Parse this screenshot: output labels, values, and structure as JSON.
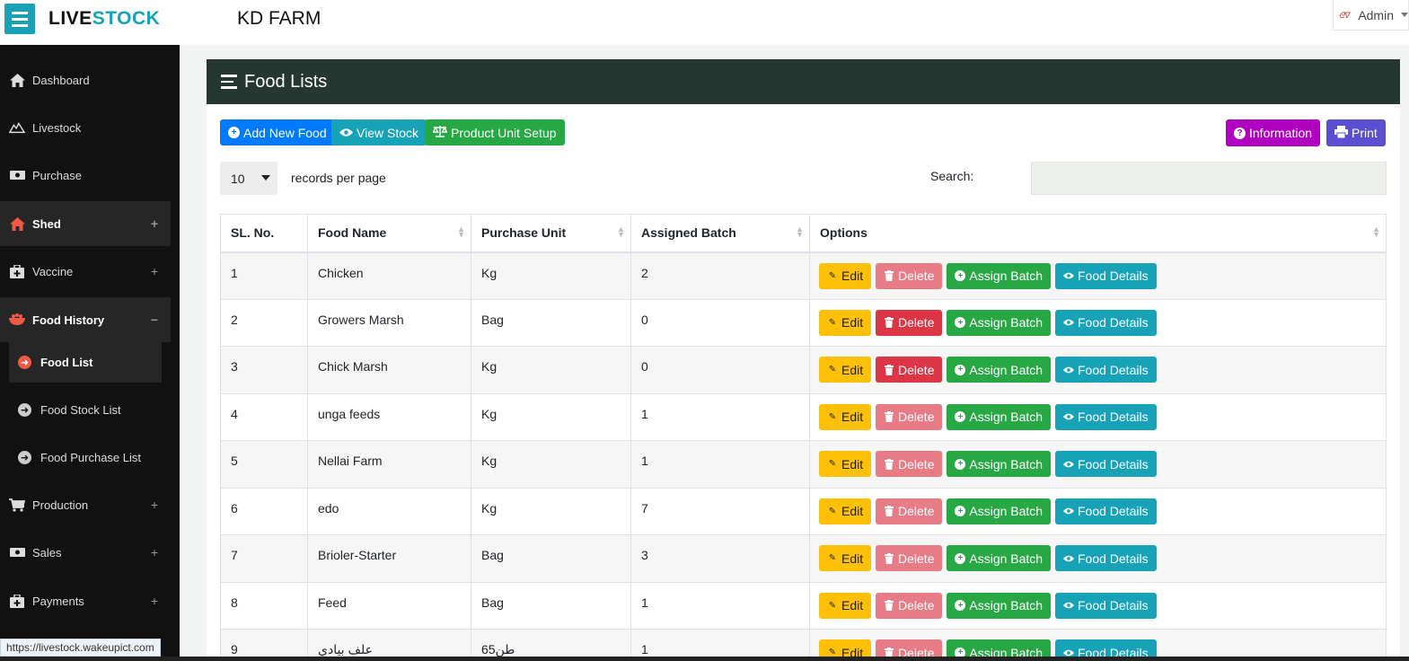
{
  "header": {
    "brand_part1": "LIVE",
    "brand_part2": "STOCK",
    "farm_name": "KD FARM",
    "user_label": "Admin"
  },
  "sidebar": {
    "items": [
      {
        "label": "Dashboard",
        "icon": "home-icon"
      },
      {
        "label": "Livestock",
        "icon": "livestock-icon"
      },
      {
        "label": "Purchase",
        "icon": "money-icon"
      },
      {
        "label": "Shed",
        "icon": "home-icon",
        "expand": "+"
      },
      {
        "label": "Vaccine",
        "icon": "medkit-icon",
        "expand": "+"
      },
      {
        "label": "Food History",
        "icon": "food-bowl-icon",
        "expand": "−"
      },
      {
        "label": "Production",
        "icon": "cart-icon",
        "expand": "+"
      },
      {
        "label": "Sales",
        "icon": "money-icon",
        "expand": "+"
      },
      {
        "label": "Payments",
        "icon": "medkit-icon",
        "expand": "+"
      }
    ],
    "sub_items": [
      {
        "label": "Food List",
        "active": true
      },
      {
        "label": "Food Stock List"
      },
      {
        "label": "Food Purchase List"
      }
    ]
  },
  "page": {
    "title": "Food Lists",
    "buttons": {
      "add_new_food": "Add New Food",
      "view_stock": "View Stock",
      "product_unit_setup": "Product Unit Setup",
      "information": "Information",
      "print": "Print"
    },
    "records_per_page_value": "10",
    "records_per_page_label": "records per page",
    "search_label": "Search:",
    "search_value": ""
  },
  "table": {
    "columns": [
      "SL. No.",
      "Food Name",
      "Purchase Unit",
      "Assigned Batch",
      "Options"
    ],
    "option_labels": {
      "edit": "Edit",
      "delete": "Delete",
      "assign_batch": "Assign Batch",
      "food_details": "Food Details"
    },
    "rows": [
      {
        "sl": "1",
        "name": "Chicken",
        "unit": "Kg",
        "batch": "2",
        "delete_enabled": false
      },
      {
        "sl": "2",
        "name": "Growers Marsh",
        "unit": "Bag",
        "batch": "0",
        "delete_enabled": true
      },
      {
        "sl": "3",
        "name": "Chick Marsh",
        "unit": "Kg",
        "batch": "0",
        "delete_enabled": true
      },
      {
        "sl": "4",
        "name": "unga feeds",
        "unit": "Kg",
        "batch": "1",
        "delete_enabled": false
      },
      {
        "sl": "5",
        "name": "Nellai Farm",
        "unit": "Kg",
        "batch": "1",
        "delete_enabled": false
      },
      {
        "sl": "6",
        "name": "edo",
        "unit": "Kg",
        "batch": "7",
        "delete_enabled": false
      },
      {
        "sl": "7",
        "name": "Brioler-Starter",
        "unit": "Bag",
        "batch": "3",
        "delete_enabled": false
      },
      {
        "sl": "8",
        "name": "Feed",
        "unit": "Bag",
        "batch": "1",
        "delete_enabled": false
      },
      {
        "sl": "9",
        "name": "علف بيادي",
        "unit": "طن65",
        "batch": "1",
        "delete_enabled": false
      }
    ]
  },
  "status_url": "https://livestock.wakeupict.com"
}
